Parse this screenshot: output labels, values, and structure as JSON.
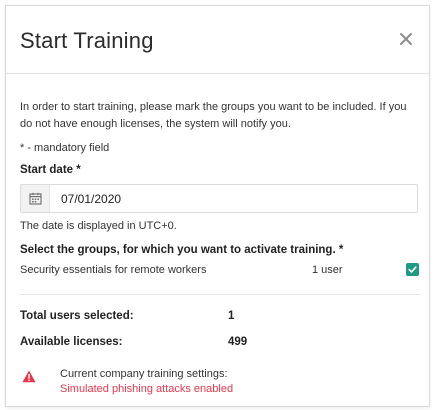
{
  "dialog": {
    "title": "Start Training",
    "close_icon": "close-icon"
  },
  "intro_text": "In order to start training, please mark the groups you want to be included. If you do not have enough licenses, the system will notify you.",
  "mandatory_note": "* - mandatory field",
  "start_date": {
    "label": "Start date *",
    "value": "07/01/2020",
    "icon": "calendar-icon",
    "note": "The date is displayed in UTC+0."
  },
  "groups": {
    "label": "Select the groups, for which you want to activate training. *",
    "items": [
      {
        "name": "Security essentials for remote workers",
        "count": "1 user",
        "checked": true
      }
    ]
  },
  "stats": {
    "total_label": "Total users selected:",
    "total_value": "1",
    "licenses_label": "Available licenses:",
    "licenses_value": "499"
  },
  "warning": {
    "icon": "warning-triangle-icon",
    "title": "Current company training settings:",
    "detail": "Simulated phishing attacks enabled"
  },
  "colors": {
    "accent": "#1f9b83",
    "warning": "#e8374b"
  }
}
